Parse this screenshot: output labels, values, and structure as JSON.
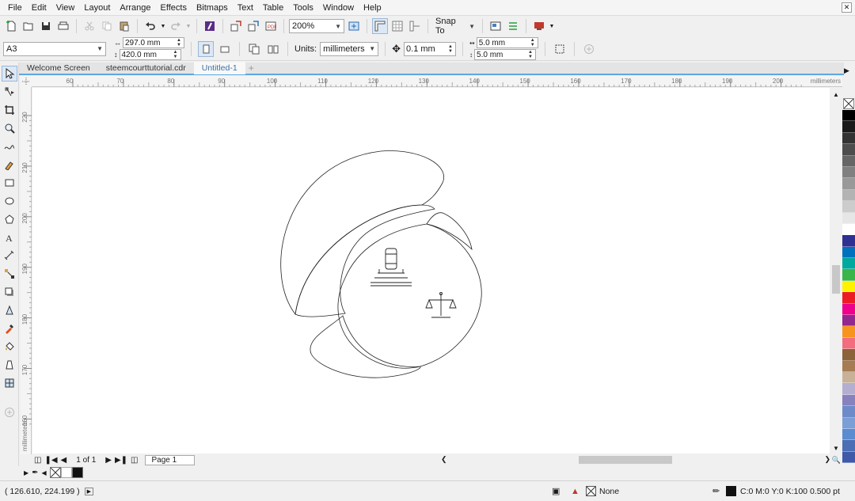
{
  "menu": [
    "File",
    "Edit",
    "View",
    "Layout",
    "Arrange",
    "Effects",
    "Bitmaps",
    "Text",
    "Table",
    "Tools",
    "Window",
    "Help"
  ],
  "standard_toolbar": {
    "zoom_value": "200%",
    "snap_label": "Snap To"
  },
  "property_bar": {
    "page_size": "A3",
    "width": "297.0 mm",
    "height": "420.0 mm",
    "units_label": "Units:",
    "units_value": "millimeters",
    "nudge": "0.1 mm",
    "dup_x": "5.0 mm",
    "dup_y": "5.0 mm"
  },
  "tabs": [
    "Welcome Screen",
    "steemcourttutorial.cdr",
    "Untitled-1"
  ],
  "active_tab": 2,
  "ruler": {
    "h_ticks": [
      "60",
      "70",
      "80",
      "90",
      "100",
      "110",
      "120",
      "130",
      "140",
      "150",
      "160",
      "170",
      "180",
      "190",
      "200"
    ],
    "h_unit": "millimeters",
    "v_ticks": [
      "220",
      "210",
      "200",
      "190",
      "180",
      "170",
      "160"
    ],
    "v_unit": "millimeters"
  },
  "page_nav": {
    "counter": "1 of 1",
    "page_tab": "Page 1"
  },
  "status": {
    "coords": "( 126.610, 224.199 )",
    "fill_label": "None",
    "outline_label": "C:0 M:0 Y:0 K:100  0.500 pt"
  },
  "palette_colors": [
    "#000000",
    "#1a1a1a",
    "#333333",
    "#4d4d4d",
    "#666666",
    "#808080",
    "#999999",
    "#b3b3b3",
    "#cccccc",
    "#e6e6e6",
    "#ffffff",
    "#2e3192",
    "#0071bc",
    "#00a99d",
    "#39b54a",
    "#fff200",
    "#ed1c24",
    "#ec008c",
    "#92278f",
    "#f7941d",
    "#f26d7d",
    "#8c6239",
    "#a67c52",
    "#c7b299",
    "#b4aed1",
    "#8781bd",
    "#6d8bc9",
    "#7b9ed6",
    "#5b8bd0",
    "#4a6fb5",
    "#3e5aa8"
  ]
}
